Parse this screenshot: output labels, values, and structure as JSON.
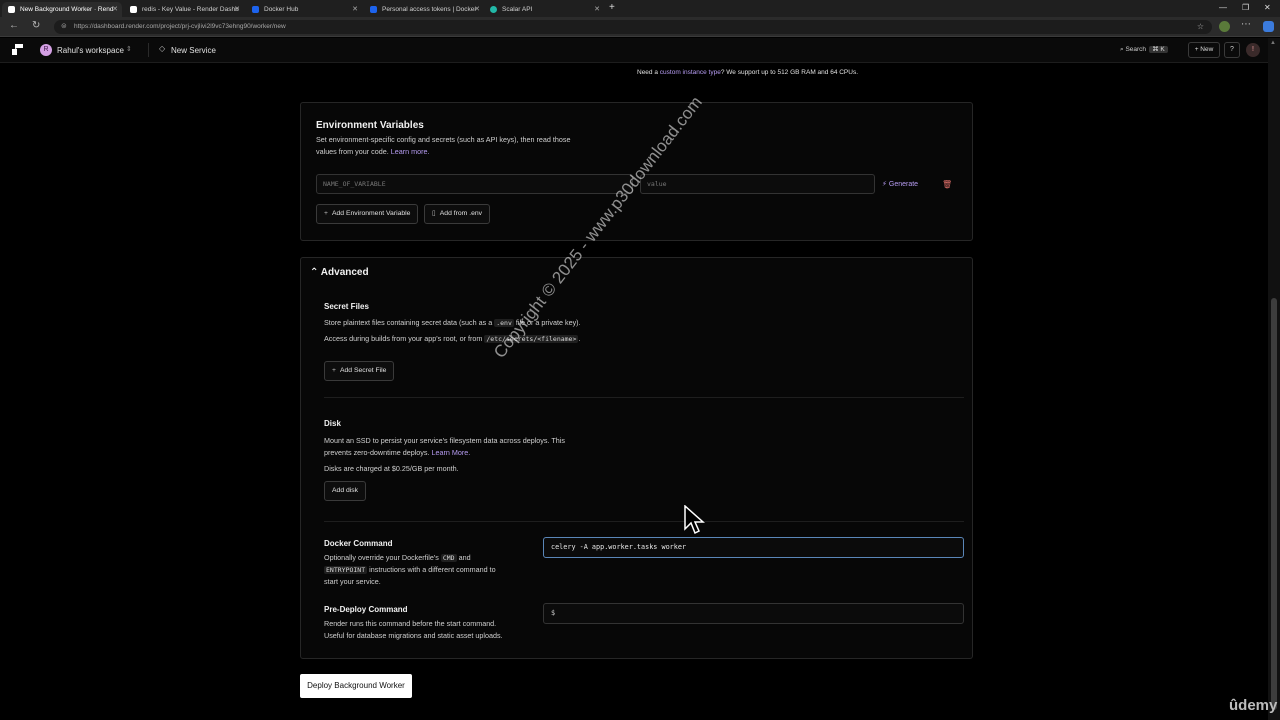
{
  "browser": {
    "tabs": [
      {
        "title": "New Background Worker · Rend",
        "color": "#ffffff",
        "active": true
      },
      {
        "title": "redis - Key Value - Render Dashb",
        "color": "#ffffff",
        "active": false
      },
      {
        "title": "Docker Hub",
        "color": "#1d63ed",
        "active": false
      },
      {
        "title": "Personal access tokens | Docker",
        "color": "#1d63ed",
        "active": false
      },
      {
        "title": "Scalar API",
        "color": "#22b8a7",
        "active": false
      }
    ],
    "new_tab": "+",
    "url": "https://dashboard.render.com/project/prj-cvjlivi2l9vc73ehng90/worker/new"
  },
  "header": {
    "workspace_initial": "R",
    "workspace_name": "Rahul's workspace",
    "breadcrumb": "New Service",
    "search_label": "Search",
    "search_shortcut": "⌘ K",
    "new_label": "New",
    "help_label": "?",
    "user_initial": "!"
  },
  "instance_note": {
    "prefix": "Need a ",
    "link": "custom instance type",
    "suffix": "? We support up to 512 GB RAM and 64 CPUs."
  },
  "env_vars": {
    "title": "Environment Variables",
    "description_1": "Set environment-specific config and secrets (such as API keys), then read those",
    "description_2": "values from your code. ",
    "learn_more": "Learn more.",
    "name_placeholder": "NAME_OF_VARIABLE",
    "value_placeholder": "value",
    "generate_label": "Generate",
    "add_variable_label": "Add Environment Variable",
    "add_from_env_label": "Add from .env"
  },
  "advanced": {
    "title": "Advanced",
    "secret_files": {
      "title": "Secret Files",
      "line1_a": "Store plaintext files containing secret data (such as a ",
      "line1_code": ".env",
      "line1_b": " file or a private key).",
      "line2_a": "Access during builds from your app's root, or from ",
      "line2_code": "/etc/secrets/<filename>",
      "line2_b": ".",
      "add_label": "Add Secret File"
    },
    "disk": {
      "title": "Disk",
      "line1": "Mount an SSD to persist your service's filesystem data across deploys. This",
      "line2_a": "prevents zero-downtime deploys. ",
      "line2_link": "Learn More.",
      "line3": "Disks are charged at $0.25/GB per month.",
      "add_label": "Add disk"
    },
    "docker_command": {
      "title": "Docker Command",
      "line1_a": "Optionally override your Dockerfile's ",
      "line1_code": "CMD",
      "line1_b": " and",
      "line2_code": "ENTRYPOINT",
      "line2_b": " instructions with a different command to",
      "line3": "start your service.",
      "value": "celery -A app.worker.tasks worker"
    },
    "pre_deploy": {
      "title": "Pre-Deploy Command",
      "line1": "Render runs this command before the start command.",
      "line2": "Useful for database migrations and static asset uploads.",
      "prefix": "$"
    }
  },
  "deploy_label": "Deploy Background Worker",
  "watermark": "Copyright © 2025 - www.p30download.com",
  "udemy": "ûdemy"
}
